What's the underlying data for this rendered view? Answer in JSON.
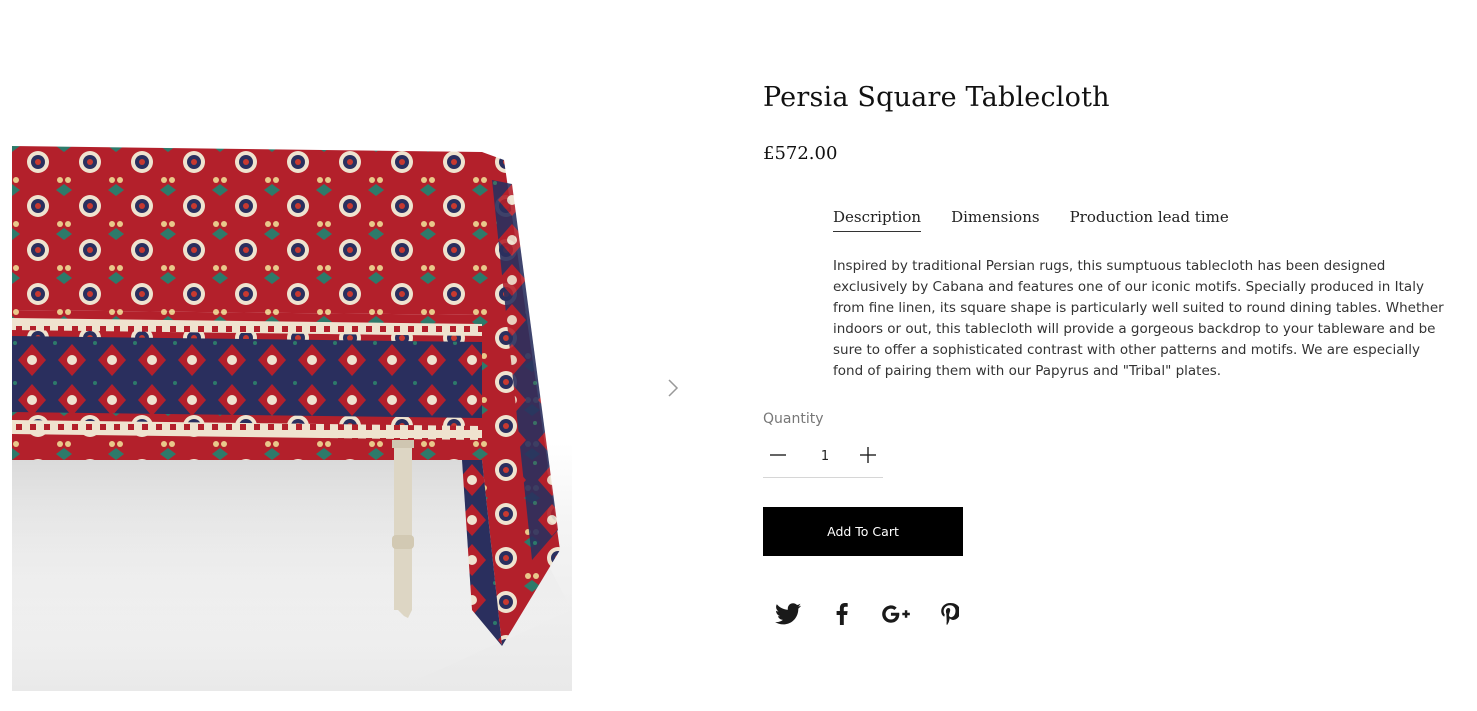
{
  "product": {
    "title": "Persia Square Tablecloth",
    "price": "£572.00"
  },
  "tabs": [
    {
      "label": "Description",
      "active": true
    },
    {
      "label": "Dimensions",
      "active": false
    },
    {
      "label": "Production lead time",
      "active": false
    }
  ],
  "description": "Inspired by traditional Persian rugs, this sumptuous tablecloth has been designed exclusively by Cabana and features one of our iconic motifs.  Specially produced in Italy from fine linen, its square shape is particularly well suited to round dining tables.  Whether indoors or out, this tablecloth will provide a gorgeous backdrop to your tableware and be sure to offer a sophisticated contrast with other patterns and motifs.  We are especially fond of pairing them with our Papyrus and \"Tribal\" plates.",
  "quantity": {
    "label": "Quantity",
    "value": "1"
  },
  "cart": {
    "button_label": "Add To Cart"
  },
  "share": {
    "icons": [
      "twitter-icon",
      "facebook-icon",
      "google-plus-icon",
      "pinterest-icon"
    ]
  },
  "gallery": {
    "next_icon": "chevron-right-icon"
  },
  "colors": {
    "accent": "#000000",
    "tablecloth_red": "#b3202b",
    "tablecloth_navy": "#2a2f5e",
    "tablecloth_cream": "#efe3cf"
  }
}
